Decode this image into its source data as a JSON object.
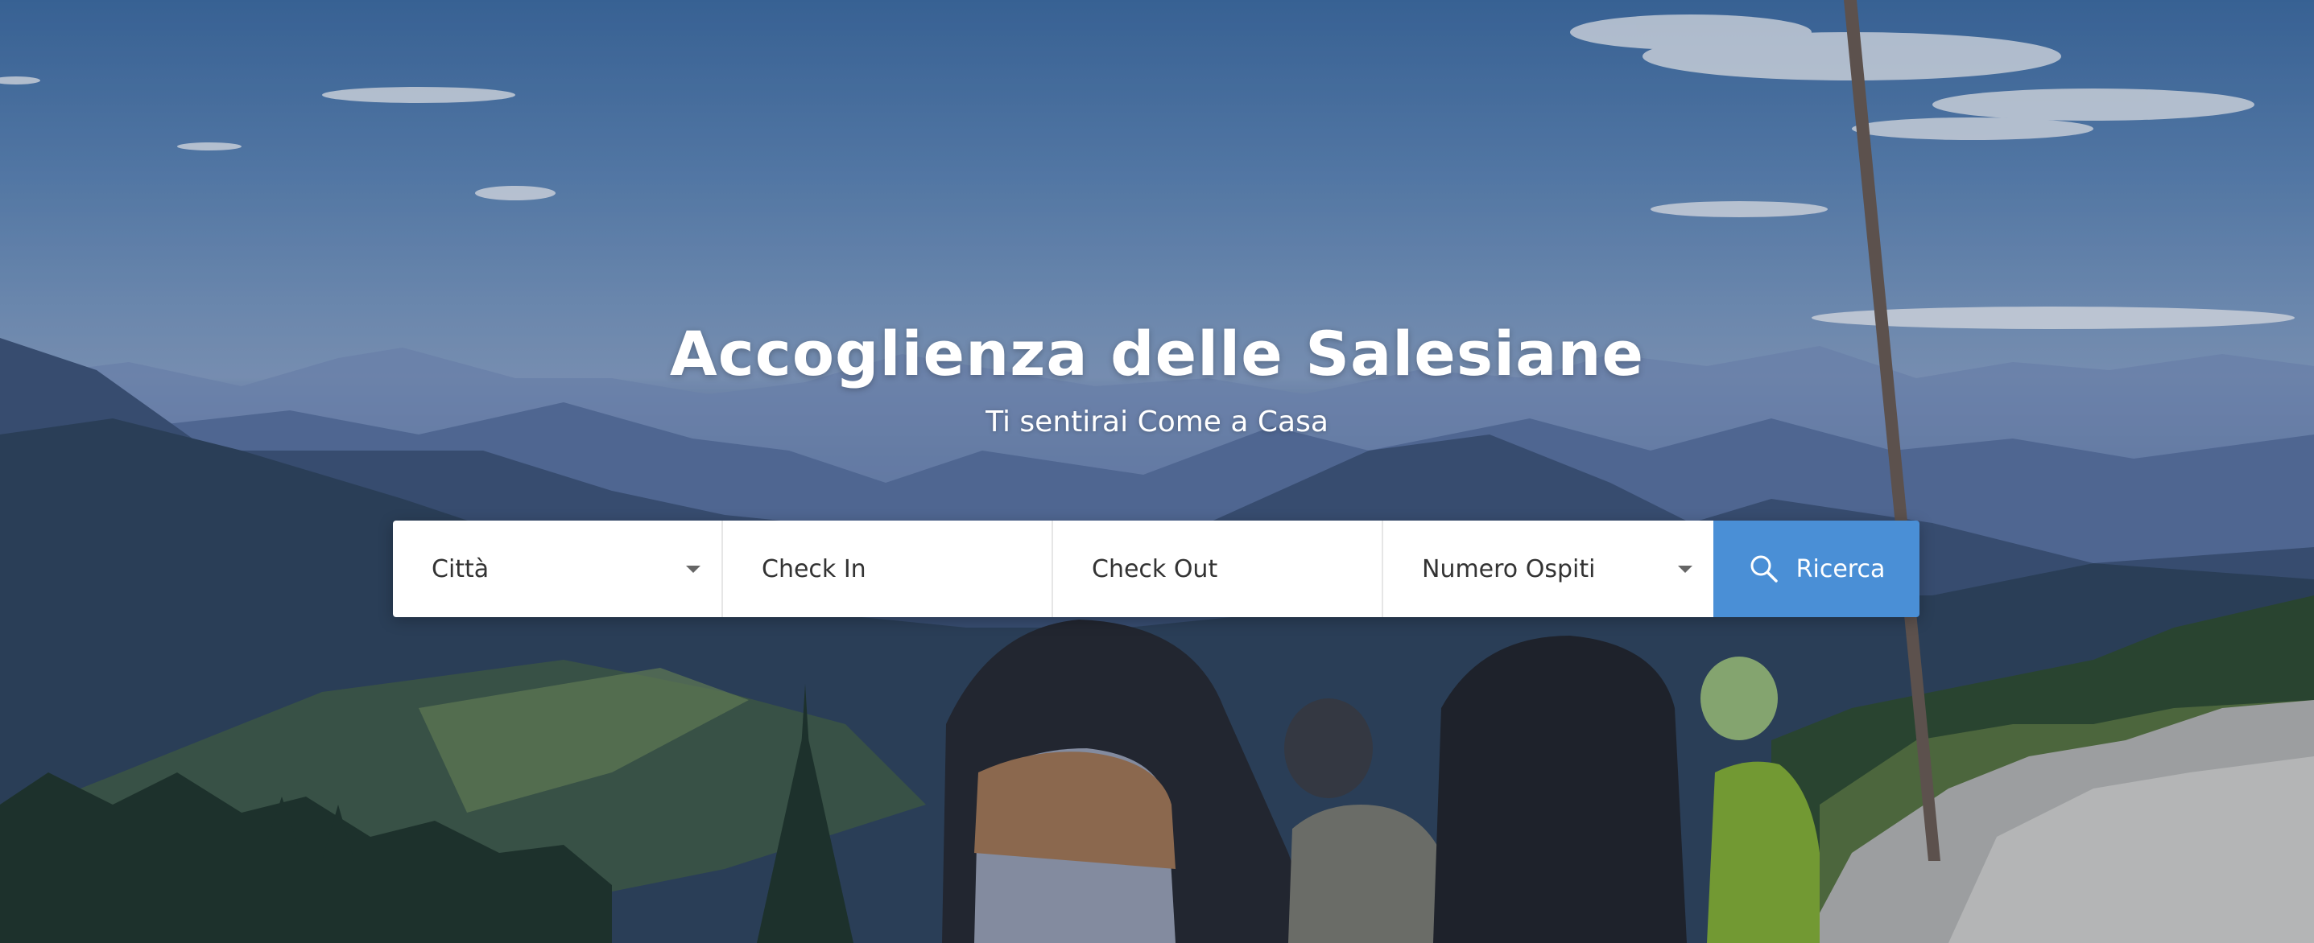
{
  "hero": {
    "title": "Accoglienza delle Salesiane",
    "subtitle": "Ti sentirai Come a Casa",
    "background_icon": "mountain-landscape-photo"
  },
  "search": {
    "city": {
      "value": "Città",
      "icon": "chevron-down-icon"
    },
    "check_in": {
      "placeholder": "Check In"
    },
    "check_out": {
      "placeholder": "Check Out"
    },
    "guests": {
      "value": "Numero Ospiti",
      "icon": "chevron-down-icon"
    },
    "button": {
      "label": "Ricerca",
      "icon": "search-icon"
    }
  },
  "colors": {
    "accent": "#4a8fd6",
    "field_bg": "#ffffff",
    "field_text": "#333333"
  }
}
